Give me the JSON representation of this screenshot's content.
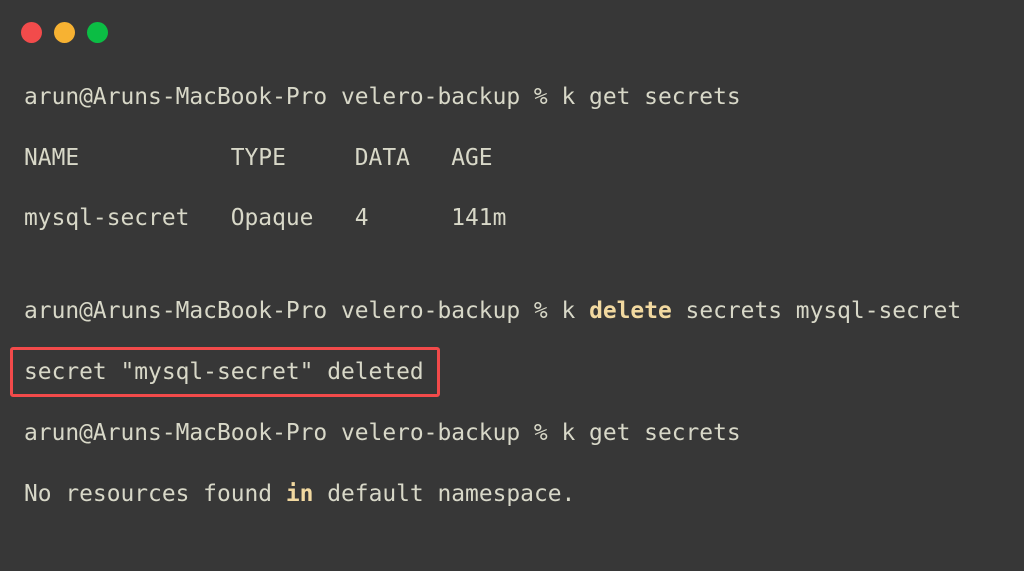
{
  "window_controls": {
    "close_color": "#f24b4b",
    "minimize_color": "#f7b232",
    "maximize_color": "#0bbd44"
  },
  "highlight_color": "#f24a4a",
  "terminal": {
    "lines": [
      {
        "prompt": "arun@Aruns-MacBook-Pro velero-backup % ",
        "cmd_pre": "k get secrets"
      },
      {
        "text": "NAME           TYPE     DATA   AGE"
      },
      {
        "text": "mysql-secret   Opaque   4      141m"
      },
      {
        "prompt": "arun@Aruns-MacBook-Pro velero-backup % ",
        "cmd_pre": "k ",
        "keyword": "delete",
        "cmd_post": " secrets mysql-secret"
      },
      {
        "text": "secret \"mysql-secret\" deleted"
      },
      {
        "prompt": "arun@Aruns-MacBook-Pro velero-backup % ",
        "cmd_pre": "k get secrets"
      },
      {
        "pre": "No resources found ",
        "keyword": "in",
        "post": " default namespace."
      }
    ]
  }
}
